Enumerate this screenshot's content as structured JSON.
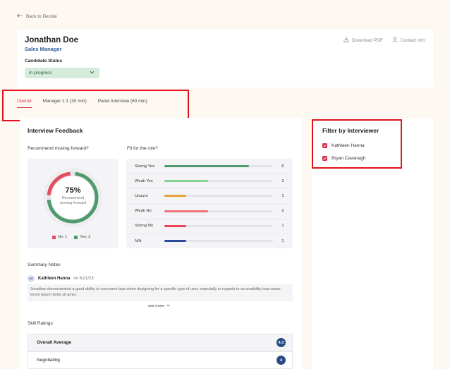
{
  "nav": {
    "back_label": "Back to Decide"
  },
  "candidate": {
    "name": "Jonathan Doe",
    "role": "Sales Manager"
  },
  "status": {
    "label": "Candidate Status",
    "value": "In progress"
  },
  "actions": {
    "download": "Download PDF",
    "contact": "Contact info"
  },
  "tabs": [
    {
      "label": "Overall",
      "active": true
    },
    {
      "label": "Manager 1:1 (30 min)",
      "active": false
    },
    {
      "label": "Panel Interview (60 min)",
      "active": false
    }
  ],
  "feedback": {
    "title": "Interview Feedback",
    "recommend_label": "Recommend moving forward?",
    "fit_label": "Fit for the role?",
    "donut": {
      "percent_text": "75%",
      "caption_line1": "Recommend",
      "caption_line2": "moving forward",
      "yes_fraction": 0.75,
      "legend": [
        {
          "label": "No: 1",
          "color": "#e44d5e"
        },
        {
          "label": "Yes: 3",
          "color": "#4f9a6c"
        }
      ]
    }
  },
  "chart_data": {
    "type": "bar",
    "categories": [
      "Strong Yes",
      "Weak Yes",
      "Unsure",
      "Weak No",
      "Strong No",
      "N/A"
    ],
    "values": [
      6,
      2,
      1,
      2,
      1,
      1
    ],
    "colors": [
      "#4f9a6c",
      "#86d297",
      "#e9a23b",
      "#f0707e",
      "#ec4458",
      "#2a4a9a"
    ],
    "fill_fraction": [
      0.78,
      0.4,
      0.2,
      0.4,
      0.2,
      0.2
    ]
  },
  "summary": {
    "label": "Summary Notes",
    "avatar": "KH",
    "author": "Kathleen Hanna",
    "date": "on 6/21/23",
    "text": "Jonathan demonstrated a good ability to overcome bias when designing for a specific type of user, especially in regards to accessibility issa cases lorem ipsum dolor sit amet.",
    "see_more": "see more"
  },
  "skills": {
    "label": "Skill Ratings",
    "rows": [
      {
        "name": "Overall Average",
        "score": "4.3"
      },
      {
        "name": "Negotiating",
        "score": "4"
      }
    ]
  },
  "filter": {
    "title": "Filter by Interviewer",
    "items": [
      {
        "name": "Kathleen Hanna",
        "checked": true
      },
      {
        "name": "Bryan Cavanagh",
        "checked": true
      }
    ]
  }
}
